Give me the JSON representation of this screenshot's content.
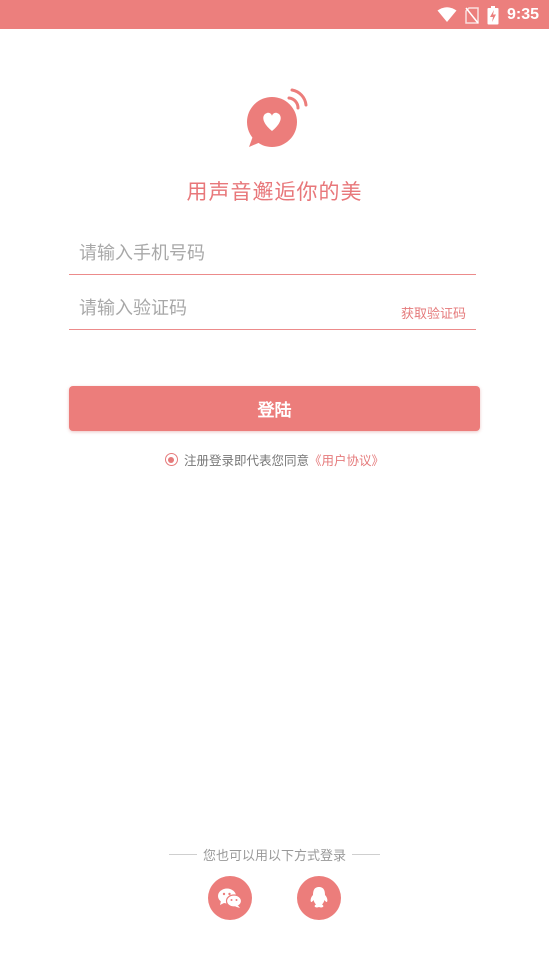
{
  "status_bar": {
    "time": "9:35",
    "icons": [
      "wifi-icon",
      "no-sim-icon",
      "battery-charging-icon"
    ],
    "bg_color": "#ec7f7d"
  },
  "logo": {
    "icon": "heart-chat-bubble-icon"
  },
  "slogan": "用声音邂逅你的美",
  "phone_field": {
    "value": "",
    "placeholder": "请输入手机号码"
  },
  "code_field": {
    "value": "",
    "placeholder": "请输入验证码",
    "get_code_label": "获取验证码"
  },
  "login_button": {
    "label": "登陆"
  },
  "agreement": {
    "text": "注册登录即代表您同意",
    "link": "《用户协议》",
    "checked": true
  },
  "other_login": {
    "label": "您也可以用以下方式登录",
    "methods": [
      {
        "name": "wechat",
        "icon": "wechat-icon"
      },
      {
        "name": "qq",
        "icon": "qq-penguin-icon"
      }
    ]
  },
  "colors": {
    "accent": "#ec7d7b",
    "accent_text": "#e57a7b",
    "placeholder": "#a8a8a8"
  }
}
